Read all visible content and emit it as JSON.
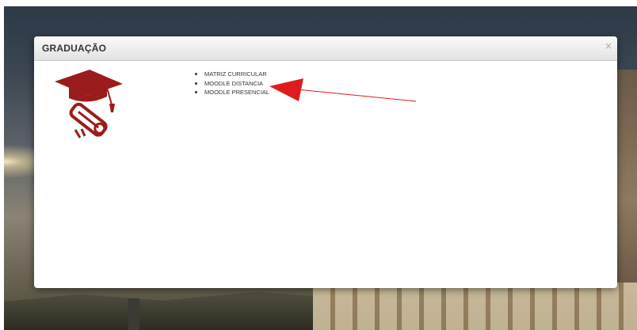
{
  "modal": {
    "title": "GRADUAÇÃO",
    "close_label": "×"
  },
  "links": [
    {
      "label": "MATRIZ CURRICULAR"
    },
    {
      "label": "MOODLE DISTANCIA"
    },
    {
      "label": "MOODLE PRESENCIAL"
    }
  ],
  "icons": {
    "modal_icon": "graduation-cap-diploma-icon",
    "annotation": "red-arrow-annotation"
  },
  "colors": {
    "icon_color": "#9b1c1c",
    "arrow_color": "#e01b1b",
    "header_text": "#333333"
  }
}
